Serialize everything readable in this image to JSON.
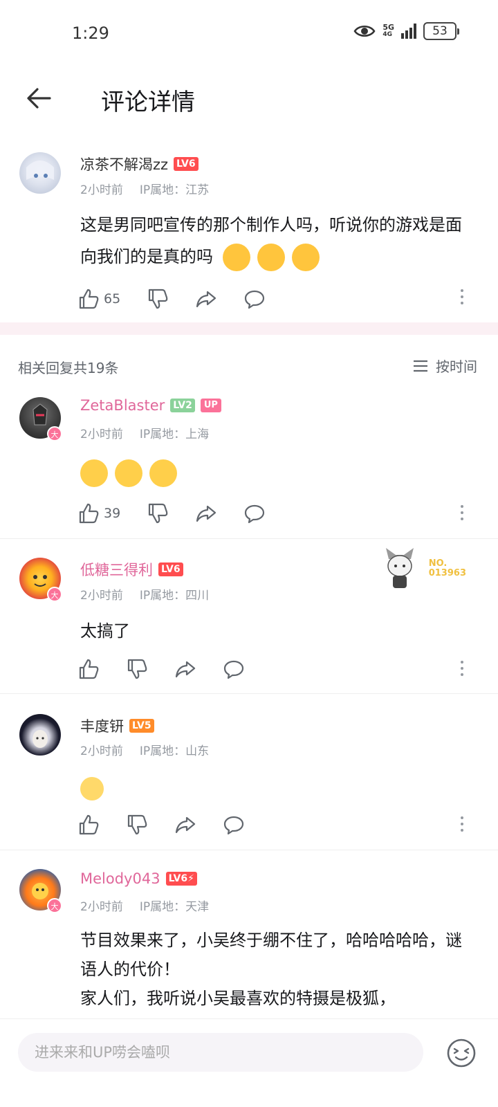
{
  "status_bar": {
    "time": "1:29",
    "battery": "53",
    "network": "5G",
    "network_sub": "4G"
  },
  "header": {
    "title": "评论详情"
  },
  "main_comment": {
    "username": "凉茶不解渴zz",
    "level": "LV6",
    "time": "2小时前",
    "ip": "IP属地：江苏",
    "text": "这是男同吧宣传的那个制作人吗，听说你的游戏是面向我们的是真的吗",
    "likes": "65"
  },
  "replies_header": {
    "count_label": "相关回复共19条",
    "sort_label": "按时间"
  },
  "replies": [
    {
      "username": "ZetaBlaster",
      "level": "LV2",
      "up_tag": "UP",
      "time": "2小时前",
      "ip": "IP属地：上海",
      "likes": "39",
      "badge": "大"
    },
    {
      "username": "低糖三得利",
      "level": "LV6",
      "time": "2小时前",
      "ip": "IP属地：四川",
      "text": "太搞了",
      "badge": "大",
      "fan_no_label": "NO.",
      "fan_no": "013963"
    },
    {
      "username": "丰度钘",
      "level": "LV5",
      "time": "2小时前",
      "ip": "IP属地：山东"
    },
    {
      "username": "Melody043",
      "level": "LV6⚡",
      "time": "2小时前",
      "ip": "IP属地：天津",
      "badge": "大",
      "text": "节目效果来了，小吴终于绷不住了，哈哈哈哈哈，谜语人的代价！",
      "text2": "家人们，我听说小吴最喜欢的特摄是极狐，"
    }
  ],
  "bottom_bar": {
    "placeholder": "进来来和UP唠会嗑呗"
  },
  "colors": {
    "accent_pink": "#fb7299",
    "username_pink": "#e0679a",
    "lv6": "#ff4d4f",
    "lv5": "#ff8c2a",
    "lv2": "#8bd29a"
  },
  "icons": [
    "back-arrow-icon",
    "like-icon",
    "dislike-icon",
    "share-icon",
    "comment-icon",
    "more-icon",
    "sort-icon",
    "emoji-icon",
    "eye-icon"
  ]
}
